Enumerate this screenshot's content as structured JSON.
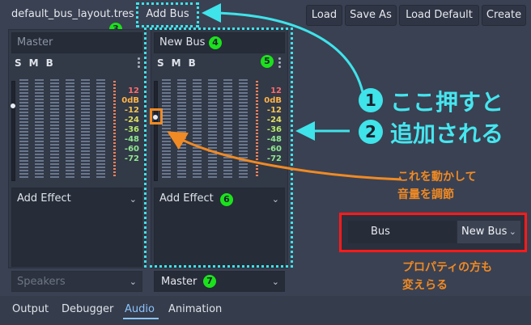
{
  "toolbar": {
    "layout_file": "default_bus_layout.tres",
    "add_bus": "Add Bus",
    "load": "Load",
    "save_as": "Save As",
    "load_default": "Load Default",
    "create": "Create"
  },
  "buses": [
    {
      "name": "Master",
      "solo": "S",
      "mute": "M",
      "bypass": "B",
      "effect_placeholder": "Add Effect",
      "send": "Speakers"
    },
    {
      "name": "New Bus",
      "solo": "S",
      "mute": "M",
      "bypass": "B",
      "effect_placeholder": "Add Effect",
      "send": "Master"
    }
  ],
  "db_scale": [
    "12",
    "0dB",
    "-12",
    "-24",
    "-36",
    "-48",
    "-60",
    "-72"
  ],
  "db_colors": [
    "#ff6b6b",
    "#ffb347",
    "#f6c453",
    "#e0e063",
    "#b6ea6b",
    "#8fe78f",
    "#8fe78f",
    "#8fe78f"
  ],
  "bottom_tabs": [
    "Output",
    "Debugger",
    "Audio",
    "Animation"
  ],
  "annotations": {
    "badges": [
      "3",
      "4",
      "5",
      "6",
      "7"
    ],
    "step1_num": "1",
    "step1_text": "ここ押すと",
    "step2_num": "2",
    "step2_text": "追加される",
    "slider_note_1": "これを動かして",
    "slider_note_2": "音量を調節",
    "property_note_1": "プロパティの方も",
    "property_note_2": "変えらる",
    "colors": {
      "cyan": "#3fe3ea",
      "orange": "#f08a24",
      "red": "#ff1a1a",
      "green": "#1be21b"
    }
  },
  "inspector": {
    "label": "Bus",
    "value": "New Bus"
  }
}
